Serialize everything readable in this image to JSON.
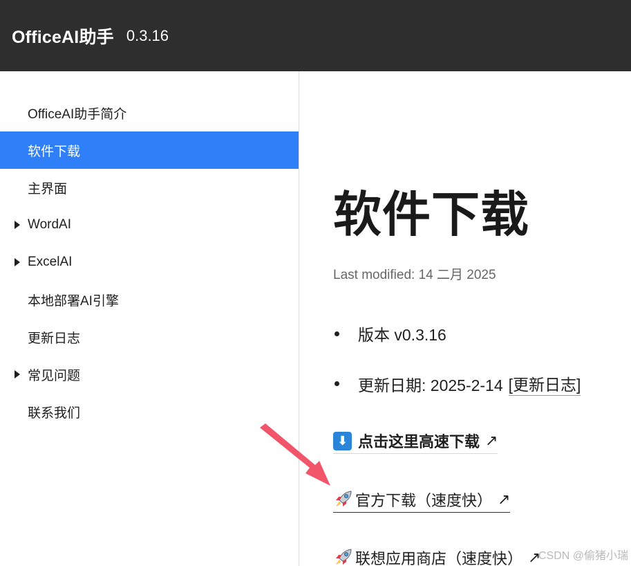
{
  "header": {
    "brand": "OfficeAI助手",
    "version": "0.3.16"
  },
  "sidebar": {
    "items": [
      {
        "label": "OfficeAI助手简介",
        "expandable": false,
        "active": false
      },
      {
        "label": "软件下载",
        "expandable": false,
        "active": true
      },
      {
        "label": "主界面",
        "expandable": false,
        "active": false
      },
      {
        "label": "WordAI",
        "expandable": true,
        "active": false
      },
      {
        "label": "ExcelAI",
        "expandable": true,
        "active": false
      },
      {
        "label": "本地部署AI引擎",
        "expandable": false,
        "active": false
      },
      {
        "label": "更新日志",
        "expandable": false,
        "active": false
      },
      {
        "label": "常见问题",
        "expandable": true,
        "active": false
      },
      {
        "label": "联系我们",
        "expandable": false,
        "active": false
      }
    ]
  },
  "main": {
    "title": "软件下载",
    "last_modified": "Last modified: 14 二月 2025",
    "version_line": "版本 v0.3.16",
    "update_date_prefix": "更新日期: 2025-2-14",
    "changelog_link": "[更新日志]",
    "links": {
      "fast_download": "点击这里高速下载",
      "official_download": "官方下载（速度快）",
      "lenovo_store": "联想应用商店（速度快）"
    },
    "external_icon": "↗",
    "down_icon": "⬇"
  },
  "watermark": "CSDN @偷猪小瑞",
  "colors": {
    "header_bg": "#2e2e2e",
    "active_bg": "#2f7ff8",
    "annotation_arrow": "#f2546a"
  }
}
